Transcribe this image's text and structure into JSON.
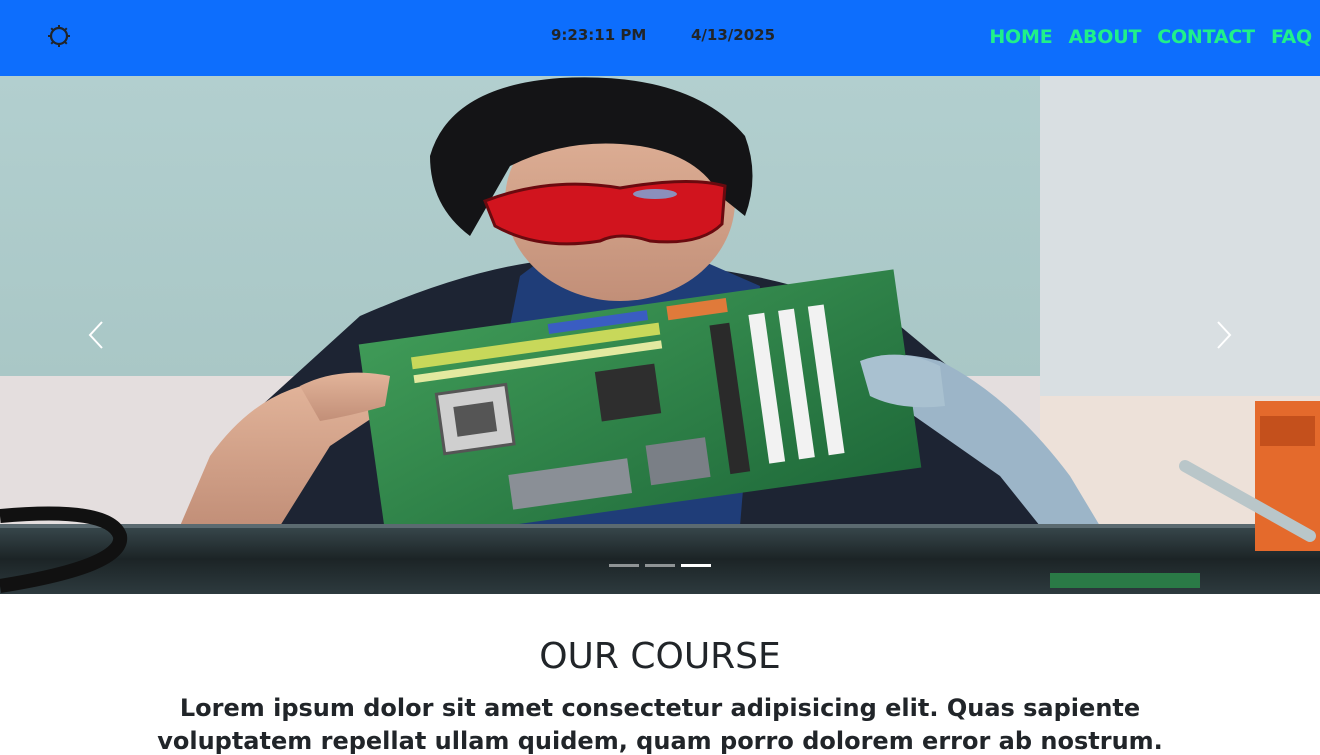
{
  "navbar": {
    "bg_color": "#0d6efd",
    "logo_icon": "gear-icon",
    "time": "9:23:11 PM",
    "date": "4/13/2025",
    "link_color": "#20f08a",
    "links": [
      {
        "label": "HOME"
      },
      {
        "label": "ABOUT"
      },
      {
        "label": "CONTACT"
      },
      {
        "label": "FAQ"
      }
    ]
  },
  "carousel": {
    "slide_count": 3,
    "active_index": 2,
    "prev_icon": "chevron-left-icon",
    "next_icon": "chevron-right-icon"
  },
  "course": {
    "title": "OUR COURSE",
    "text": "Lorem ipsum dolor sit amet consectetur adipisicing elit. Quas sapiente voluptatem repellat ullam quidem, quam porro dolorem error ab nostrum."
  }
}
